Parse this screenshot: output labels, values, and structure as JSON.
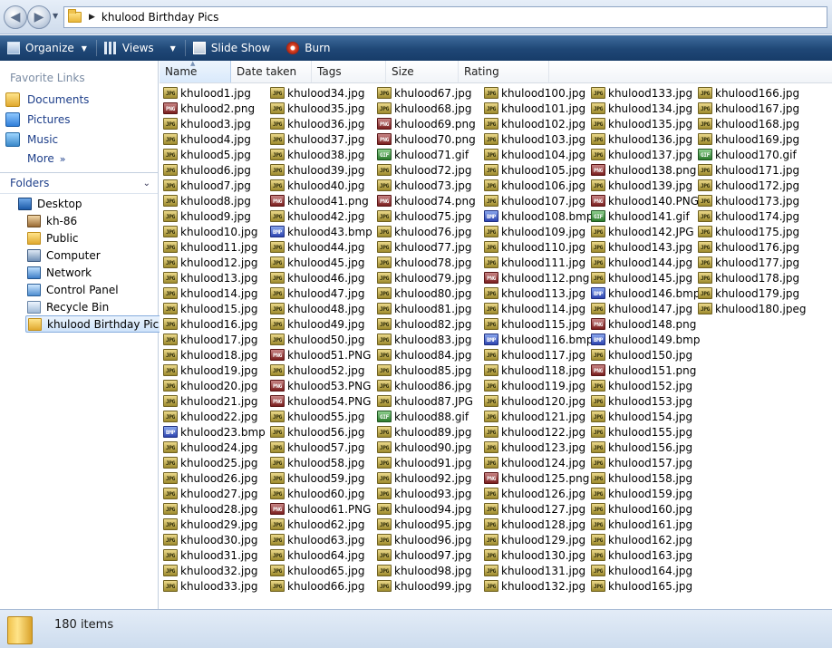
{
  "address": {
    "path": "khulood Birthday Pics"
  },
  "toolbar": {
    "organize": "Organize",
    "views": "Views",
    "slideshow": "Slide Show",
    "burn": "Burn"
  },
  "nav": {
    "favorites_title": "Favorite Links",
    "favorites": [
      "Documents",
      "Pictures",
      "Music"
    ],
    "more": "More",
    "folders_title": "Folders",
    "tree": [
      "Desktop",
      "kh-86",
      "Public",
      "Computer",
      "Network",
      "Control Panel",
      "Recycle Bin",
      "khulood Birthday Pics"
    ]
  },
  "columns": {
    "name": "Name",
    "date": "Date taken",
    "tags": "Tags",
    "size": "Size",
    "rating": "Rating"
  },
  "files": [
    "khulood1.jpg",
    "khulood2.png",
    "khulood3.jpg",
    "khulood4.jpg",
    "khulood5.jpg",
    "khulood6.jpg",
    "khulood7.jpg",
    "khulood8.jpg",
    "khulood9.jpg",
    "khulood10.jpg",
    "khulood11.jpg",
    "khulood12.jpg",
    "khulood13.jpg",
    "khulood14.jpg",
    "khulood15.jpg",
    "khulood16.jpg",
    "khulood17.jpg",
    "khulood18.jpg",
    "khulood19.jpg",
    "khulood20.jpg",
    "khulood21.jpg",
    "khulood22.jpg",
    "khulood23.bmp",
    "khulood24.jpg",
    "khulood25.jpg",
    "khulood26.jpg",
    "khulood27.jpg",
    "khulood28.jpg",
    "khulood29.jpg",
    "khulood30.jpg",
    "khulood31.jpg",
    "khulood32.jpg",
    "khulood33.jpg",
    "khulood34.jpg",
    "khulood35.jpg",
    "khulood36.jpg",
    "khulood37.jpg",
    "khulood38.jpg",
    "khulood39.jpg",
    "khulood40.jpg",
    "khulood41.png",
    "khulood42.jpg",
    "khulood43.bmp",
    "khulood44.jpg",
    "khulood45.jpg",
    "khulood46.jpg",
    "khulood47.jpg",
    "khulood48.jpg",
    "khulood49.jpg",
    "khulood50.jpg",
    "khulood51.PNG",
    "khulood52.jpg",
    "khulood53.PNG",
    "khulood54.PNG",
    "khulood55.jpg",
    "khulood56.jpg",
    "khulood57.jpg",
    "khulood58.jpg",
    "khulood59.jpg",
    "khulood60.jpg",
    "khulood61.PNG",
    "khulood62.jpg",
    "khulood63.jpg",
    "khulood64.jpg",
    "khulood65.jpg",
    "khulood66.jpg",
    "khulood67.jpg",
    "khulood68.jpg",
    "khulood69.png",
    "khulood70.png",
    "khulood71.gif",
    "khulood72.jpg",
    "khulood73.jpg",
    "khulood74.png",
    "khulood75.jpg",
    "khulood76.jpg",
    "khulood77.jpg",
    "khulood78.jpg",
    "khulood79.jpg",
    "khulood80.jpg",
    "khulood81.jpg",
    "khulood82.jpg",
    "khulood83.jpg",
    "khulood84.jpg",
    "khulood85.jpg",
    "khulood86.jpg",
    "khulood87.JPG",
    "khulood88.gif",
    "khulood89.jpg",
    "khulood90.jpg",
    "khulood91.jpg",
    "khulood92.jpg",
    "khulood93.jpg",
    "khulood94.jpg",
    "khulood95.jpg",
    "khulood96.jpg",
    "khulood97.jpg",
    "khulood98.jpg",
    "khulood99.jpg",
    "khulood100.jpg",
    "khulood101.jpg",
    "khulood102.jpg",
    "khulood103.jpg",
    "khulood104.jpg",
    "khulood105.jpg",
    "khulood106.jpg",
    "khulood107.jpg",
    "khulood108.bmp",
    "khulood109.jpg",
    "khulood110.jpg",
    "khulood111.jpg",
    "khulood112.png",
    "khulood113.jpg",
    "khulood114.jpg",
    "khulood115.jpg",
    "khulood116.bmp",
    "khulood117.jpg",
    "khulood118.jpg",
    "khulood119.jpg",
    "khulood120.jpg",
    "khulood121.jpg",
    "khulood122.jpg",
    "khulood123.jpg",
    "khulood124.jpg",
    "khulood125.png",
    "khulood126.jpg",
    "khulood127.jpg",
    "khulood128.jpg",
    "khulood129.jpg",
    "khulood130.jpg",
    "khulood131.jpg",
    "khulood132.jpg",
    "khulood133.jpg",
    "khulood134.jpg",
    "khulood135.jpg",
    "khulood136.jpg",
    "khulood137.jpg",
    "khulood138.png",
    "khulood139.jpg",
    "khulood140.PNG",
    "khulood141.gif",
    "khulood142.JPG",
    "khulood143.jpg",
    "khulood144.jpg",
    "khulood145.jpg",
    "khulood146.bmp",
    "khulood147.jpg",
    "khulood148.png",
    "khulood149.bmp",
    "khulood150.jpg",
    "khulood151.png",
    "khulood152.jpg",
    "khulood153.jpg",
    "khulood154.jpg",
    "khulood155.jpg",
    "khulood156.jpg",
    "khulood157.jpg",
    "khulood158.jpg",
    "khulood159.jpg",
    "khulood160.jpg",
    "khulood161.jpg",
    "khulood162.jpg",
    "khulood163.jpg",
    "khulood164.jpg",
    "khulood165.jpg",
    "khulood166.jpg",
    "khulood167.jpg",
    "khulood168.jpg",
    "khulood169.jpg",
    "khulood170.gif",
    "khulood171.jpg",
    "khulood172.jpg",
    "khulood173.jpg",
    "khulood174.jpg",
    "khulood175.jpg",
    "khulood176.jpg",
    "khulood177.jpg",
    "khulood178.jpg",
    "khulood179.jpg",
    "khulood180.jpeg"
  ],
  "icons": {
    "jpg": "jpg-file-icon",
    "png": "png-file-icon",
    "gif": "gif-file-icon",
    "bmp": "bmp-file-icon",
    "folder": "folder-icon",
    "back": "back-arrow-icon",
    "forward": "forward-arrow-icon"
  },
  "status": {
    "count": "180 items"
  }
}
